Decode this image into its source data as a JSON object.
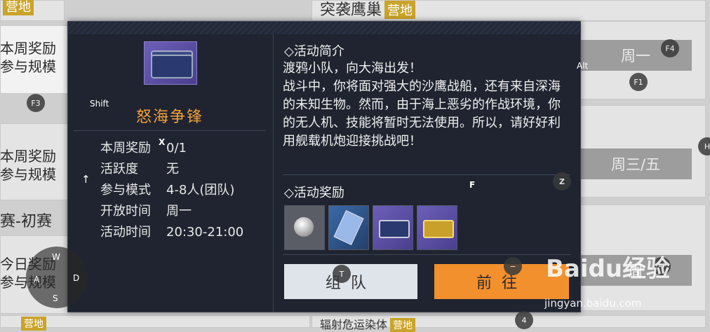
{
  "background": {
    "left_col": [
      {
        "title": "",
        "tag": "营地"
      },
      {
        "text1": "本周奖励",
        "text2": "参与规模"
      },
      {
        "text1": "本周奖励",
        "text2": "参与规模"
      },
      {
        "title": "赛-初赛"
      },
      {
        "text1": "今日奖励",
        "text2": "参与规模"
      }
    ],
    "right_top_title": "突袭鹰巢",
    "right_top_tag": "营地",
    "btn_mon": "周一",
    "btn_wed_fri": "周三/五",
    "btn_partial": "周",
    "right_bottom_title": "辐射危运染体",
    "right_bottom_tag": "营地",
    "left_bottom_tag": "营地"
  },
  "modal": {
    "event_name": "怒海争锋",
    "info": [
      {
        "key": "本周奖励",
        "value": "0/1"
      },
      {
        "key": "活跃度",
        "value": "无"
      },
      {
        "key": "参与模式",
        "value": "4-8人(团队)"
      },
      {
        "key": "开放时间",
        "value": "周一"
      },
      {
        "key": "活动时间",
        "value": "20:30-21:00"
      }
    ],
    "intro_title": "◇活动简介",
    "intro_text": "渡鸦小队，向大海出发！\n战斗中，你将面对强大的沙鹰战船，还有来自深海的未知生物。然而，由于海上恶劣的作战环境，你的无人机、技能将暂时无法使用。所以，请好好利用舰载机炮迎接挑战吧！",
    "reward_title": "◇活动奖励",
    "btn_team": "组队",
    "btn_go": "前往"
  },
  "keys": {
    "shift": "Shift",
    "f3": "F3",
    "x": "X",
    "alt": "Alt",
    "f4": "F4",
    "f1": "F1",
    "f": "F",
    "z": "Z",
    "h": "H",
    "t": "T",
    "up": "↑",
    "minus": "−",
    "arrow": "→",
    "w": "W",
    "a": "A",
    "s": "S",
    "d": "D",
    "four": "4"
  },
  "watermark": {
    "brand": "Baidu经验",
    "url": "jingyan.baidu.com"
  }
}
